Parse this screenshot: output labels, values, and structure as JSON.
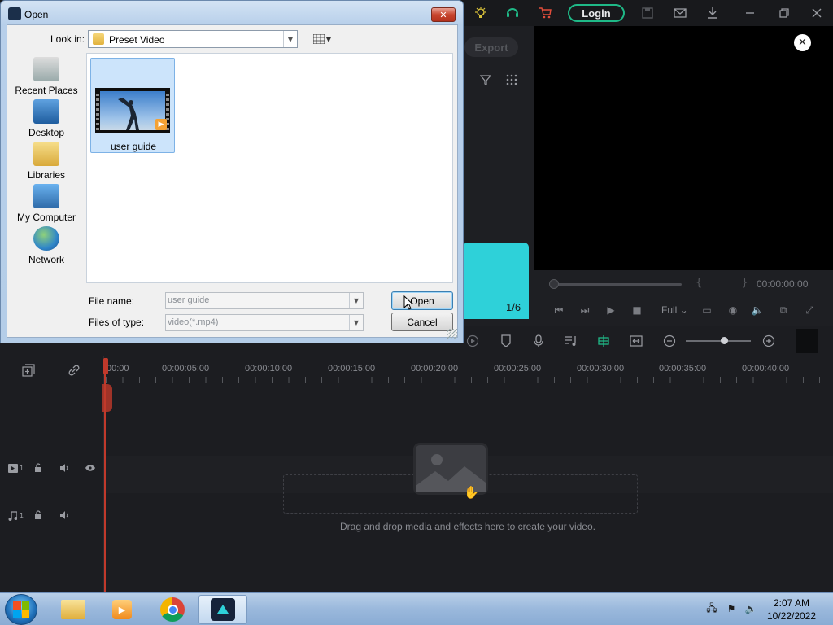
{
  "editor": {
    "login_label": "Login",
    "export_label": "Export",
    "media_counter": "1/6",
    "timecode": "00:00:00:00",
    "braces": "{ }",
    "quality": "Full",
    "ruler_labels": [
      "00:00",
      "00:00:05:00",
      "00:00:10:00",
      "00:00:15:00",
      "00:00:20:00",
      "00:00:25:00",
      "00:00:30:00",
      "00:00:35:00",
      "00:00:40:00"
    ],
    "video_track_num": "1",
    "audio_track_num": "1",
    "drop_hint": "Drag and drop media and effects here to create your video.",
    "accent_color": "#1fb987"
  },
  "dialog": {
    "title": "Open",
    "look_in_label": "Look in:",
    "look_in_value": "Preset Video",
    "places": [
      {
        "label": "Recent Places",
        "icon": "recent-places-icon"
      },
      {
        "label": "Desktop",
        "icon": "desktop-icon"
      },
      {
        "label": "Libraries",
        "icon": "libraries-icon"
      },
      {
        "label": "My Computer",
        "icon": "computer-icon"
      },
      {
        "label": "Network",
        "icon": "network-icon"
      }
    ],
    "files": [
      {
        "name": "user guide"
      }
    ],
    "file_name_label": "File name:",
    "file_name_value": "user guide",
    "file_type_label": "Files of type:",
    "file_type_value": "video(*.mp4)",
    "open_label": "Open",
    "cancel_label": "Cancel"
  },
  "taskbar": {
    "time": "2:07 AM",
    "date": "10/22/2022"
  }
}
